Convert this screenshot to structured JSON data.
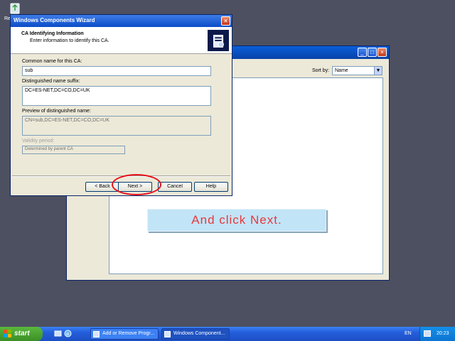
{
  "desktop": {
    "recycle_label": "Re"
  },
  "bg_window": {
    "sort_label": "Sort by:",
    "sort_value": "Name"
  },
  "wizard": {
    "title": "Windows Components Wizard",
    "header_title": "CA Identifying Information",
    "header_subtitle": "Enter information to identify this CA.",
    "common_name_label": "Common name for this CA:",
    "common_name_value": "sub",
    "dn_suffix_label": "Distinguished name suffix:",
    "dn_suffix_value": "DC=ES-NET,DC=CO,DC=UK",
    "preview_label": "Preview of distinguished name:",
    "preview_value": "CN=sub,DC=ES-NET,DC=CO,DC=UK",
    "validity_label": "Validity period:",
    "validity_value": "Determined by parent CA",
    "buttons": {
      "back": "< Back",
      "next": "Next >",
      "cancel": "Cancel",
      "help": "Help"
    }
  },
  "callout": {
    "text": "And click Next."
  },
  "taskbar": {
    "start_label": "start",
    "tasks": [
      {
        "label": "Add or Remove Progr..."
      },
      {
        "label": "Windows Component..."
      }
    ],
    "language": "EN",
    "clock": "20:23"
  },
  "colors": {
    "highlight": "#e8101a",
    "callout_text": "#e8383a",
    "callout_bg": "#c2e4f7",
    "title_bar": "#0a4cc8",
    "desktop_bg": "#4d5060"
  }
}
